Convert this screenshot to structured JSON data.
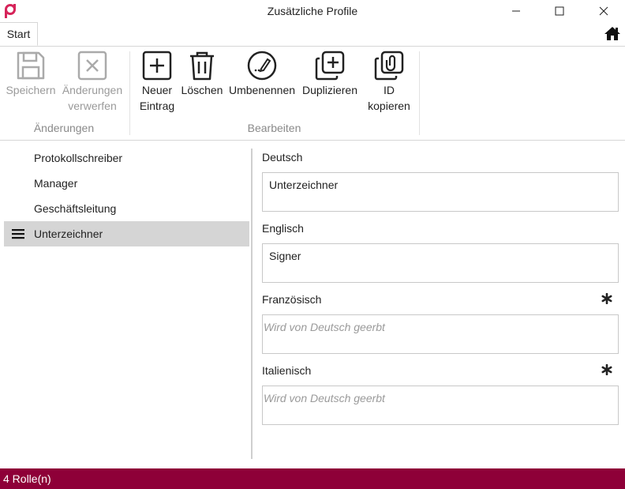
{
  "window": {
    "title": "Zusätzliche Profile"
  },
  "tabs": [
    {
      "label": "Start"
    }
  ],
  "ribbon": {
    "buttons": [
      {
        "id": "save",
        "label": "Speichern",
        "label2": "",
        "icon": "save-icon",
        "enabled": false
      },
      {
        "id": "discard",
        "label": "Änderungen",
        "label2": "verwerfen",
        "icon": "discard-icon",
        "enabled": false
      },
      {
        "id": "new",
        "label": "Neuer",
        "label2": "Eintrag",
        "icon": "plus-square-icon",
        "enabled": true
      },
      {
        "id": "delete",
        "label": "Löschen",
        "label2": "",
        "icon": "trash-icon",
        "enabled": true
      },
      {
        "id": "rename",
        "label": "Umbenennen",
        "label2": "",
        "icon": "rename-icon",
        "enabled": true
      },
      {
        "id": "duplicate",
        "label": "Duplizieren",
        "label2": "",
        "icon": "duplicate-icon",
        "enabled": true
      },
      {
        "id": "copyid",
        "label": "ID",
        "label2": "kopieren",
        "icon": "copy-id-icon",
        "enabled": true
      }
    ],
    "groups": [
      {
        "label": "Änderungen"
      },
      {
        "label": "Bearbeiten"
      }
    ]
  },
  "list": {
    "items": [
      {
        "label": "Protokollschreiber",
        "selected": false
      },
      {
        "label": "Manager",
        "selected": false
      },
      {
        "label": "Geschäftsleitung",
        "selected": false
      },
      {
        "label": "Unterzeichner",
        "selected": true
      }
    ]
  },
  "form": {
    "fields": [
      {
        "label": "Deutsch",
        "value": "Unterzeichner",
        "placeholder": "",
        "inherited": false
      },
      {
        "label": "Englisch",
        "value": "Signer",
        "placeholder": "",
        "inherited": false
      },
      {
        "label": "Französisch",
        "value": "",
        "placeholder": "Wird von Deutsch geerbt",
        "inherited": true
      },
      {
        "label": "Italienisch",
        "value": "",
        "placeholder": "Wird von Deutsch geerbt",
        "inherited": true
      }
    ]
  },
  "status": {
    "text": "4 Rolle(n)"
  },
  "colors": {
    "accent": "#8e0038",
    "logo": "#d6245a",
    "selection": "#d5d5d5"
  }
}
